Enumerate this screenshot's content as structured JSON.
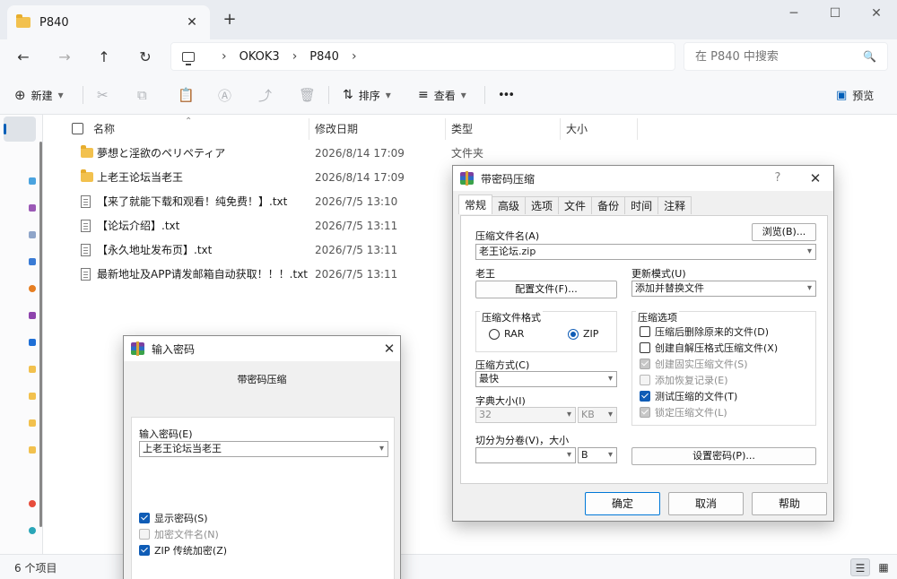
{
  "window": {
    "tab_title": "P840",
    "tab_close": "✕",
    "new_tab": "+",
    "minimize": "─",
    "maximize": "☐",
    "close": "✕"
  },
  "nav": {
    "back": "←",
    "forward": "→",
    "up": "↑",
    "refresh": "↻",
    "breadcrumb": [
      "OKOK3",
      "P840"
    ],
    "sep": "›",
    "search_placeholder": "在 P840 中搜索"
  },
  "toolbar": {
    "new_label": "新建",
    "sort_label": "排序",
    "view_label": "查看",
    "more": "•••",
    "preview_label": "预览"
  },
  "columns": {
    "name": "名称",
    "modified": "修改日期",
    "type": "类型",
    "size": "大小"
  },
  "files": [
    {
      "name": "夢想と淫欲のペリペティア",
      "modified": "2026/8/14 17:09",
      "type": "文件夹",
      "kind": "folder"
    },
    {
      "name": "上老王论坛当老王",
      "modified": "2026/8/14 17:09",
      "type": "",
      "kind": "folder"
    },
    {
      "name": "【来了就能下载和观看！纯免费！】.txt",
      "modified": "2026/7/5 13:10",
      "type": "",
      "kind": "txt"
    },
    {
      "name": "【论坛介绍】.txt",
      "modified": "2026/7/5 13:11",
      "type": "",
      "kind": "txt"
    },
    {
      "name": "【永久地址发布页】.txt",
      "modified": "2026/7/5 13:11",
      "type": "",
      "kind": "txt"
    },
    {
      "name": "最新地址及APP请发邮箱自动获取！！！.txt",
      "modified": "2026/7/5 13:11",
      "type": "",
      "kind": "txt"
    }
  ],
  "status": {
    "count": "6 个项目"
  },
  "archive_dialog": {
    "title": "带密码压缩",
    "help_btn": "?",
    "close_btn": "✕",
    "tabs": [
      "常规",
      "高级",
      "选项",
      "文件",
      "备份",
      "时间",
      "注释"
    ],
    "archive_name_label": "压缩文件名(A)",
    "browse": "浏览(B)...",
    "archive_name_value": "老王论坛.zip",
    "profile_label": "老王",
    "profile_btn": "配置文件(F)...",
    "update_mode_label": "更新模式(U)",
    "update_mode_value": "添加并替换文件",
    "format_group": "压缩文件格式",
    "rar": "RAR",
    "zip": "ZIP",
    "method_label": "压缩方式(C)",
    "method_value": "最快",
    "dict_label": "字典大小(I)",
    "dict_value": "32",
    "dict_unit": "KB",
    "split_label": "切分为分卷(V)，大小",
    "split_value": "",
    "split_unit": "B",
    "options_group": "压缩选项",
    "opt1": "压缩后删除原来的文件(D)",
    "opt2": "创建自解压格式压缩文件(X)",
    "opt3": "创建固实压缩文件(S)",
    "opt4": "添加恢复记录(E)",
    "opt5": "测试压缩的文件(T)",
    "opt6": "锁定压缩文件(L)",
    "set_password": "设置密码(P)...",
    "ok": "确定",
    "cancel": "取消",
    "help": "帮助"
  },
  "password_dialog": {
    "title": "输入密码",
    "close_btn": "✕",
    "subtitle": "带密码压缩",
    "pwd_label": "输入密码(E)",
    "pwd_value": "上老王论坛当老王",
    "show_pwd": "显示密码(S)",
    "encrypt_names": "加密文件名(N)",
    "zip_legacy": "ZIP 传统加密(Z)"
  },
  "icons": {
    "arrow": "▾"
  }
}
